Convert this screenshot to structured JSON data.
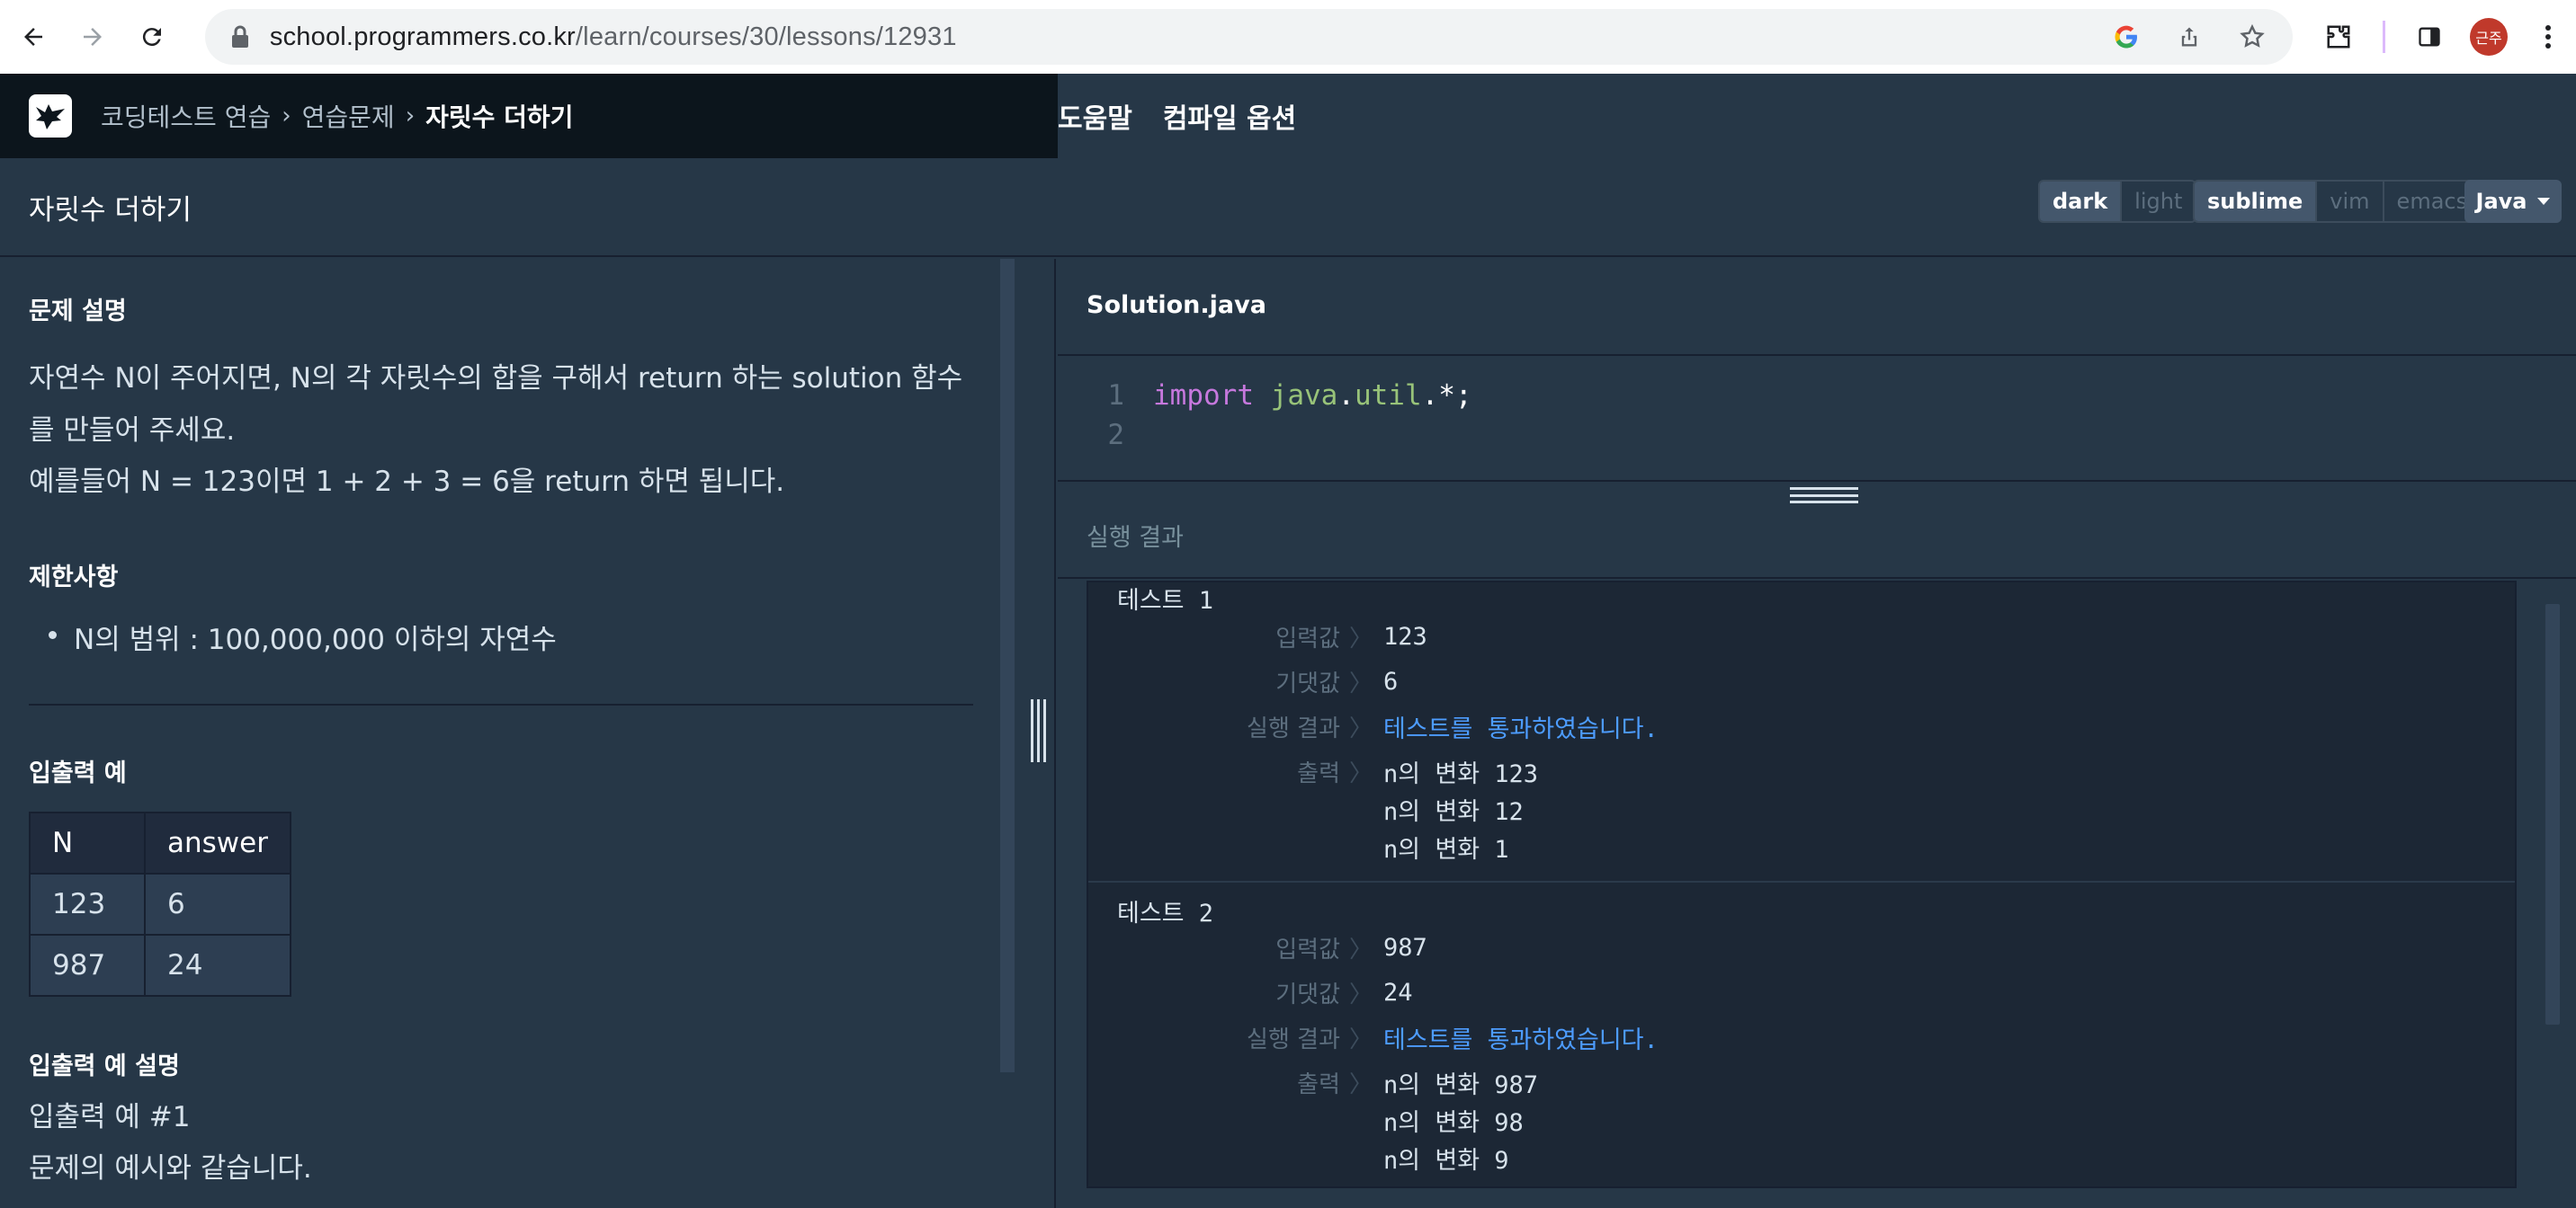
{
  "browser": {
    "url_host": "school.programmers.co.kr",
    "url_path": "/learn/courses/30/lessons/12931",
    "avatar_text": "근주"
  },
  "header": {
    "breadcrumb": [
      "코딩테스트 연습",
      "연습문제",
      "자릿수 더하기"
    ],
    "help": "도움말",
    "compile_options": "컴파일 옵션"
  },
  "titlebar": {
    "title": "자릿수 더하기",
    "theme": [
      "dark",
      "light"
    ],
    "keymap": [
      "sublime",
      "vim",
      "emacs"
    ],
    "language": "Java"
  },
  "problem": {
    "desc_heading": "문제 설명",
    "desc_line1": "자연수 N이 주어지면, N의 각 자릿수의 합을 구해서 return 하는 solution 함수",
    "desc_line2": "를 만들어 주세요.",
    "desc_line3": "예를들어 N = 123이면 1 + 2 + 3 = 6을 return 하면 됩니다.",
    "constraints_heading": "제한사항",
    "constraint_1": "N의 범위 : 100,000,000 이하의 자연수",
    "io_heading": "입출력 예",
    "io_table": {
      "headers": [
        "N",
        "answer"
      ],
      "rows": [
        [
          "123",
          "6"
        ],
        [
          "987",
          "24"
        ]
      ]
    },
    "io_desc_heading": "입출력 예 설명",
    "io_desc_sub": "입출력 예 #1",
    "io_desc_text": "문제의 예시와 같습니다."
  },
  "editor": {
    "filename": "Solution.java",
    "lines": [
      {
        "num": "1",
        "kw": "import",
        "pkg1": "java",
        "pkg2": "util",
        "rest": ".*;"
      },
      {
        "num": "2"
      }
    ]
  },
  "results": {
    "heading": "실행 결과",
    "labels": {
      "input": "입력값",
      "expected": "기댓값",
      "result": "실행 결과",
      "output": "출력"
    },
    "tests": [
      {
        "title": "테스트 1",
        "input": "123",
        "expected": "6",
        "result": "테스트를 통과하였습니다.",
        "output": [
          "n의 변화 123",
          "n의 변화 12",
          "n의 변화 1"
        ]
      },
      {
        "title": "테스트 2",
        "input": "987",
        "expected": "24",
        "result": "테스트를 통과하였습니다.",
        "output": [
          "n의 변화 987",
          "n의 변화 98",
          "n의 변화 9"
        ]
      }
    ]
  }
}
